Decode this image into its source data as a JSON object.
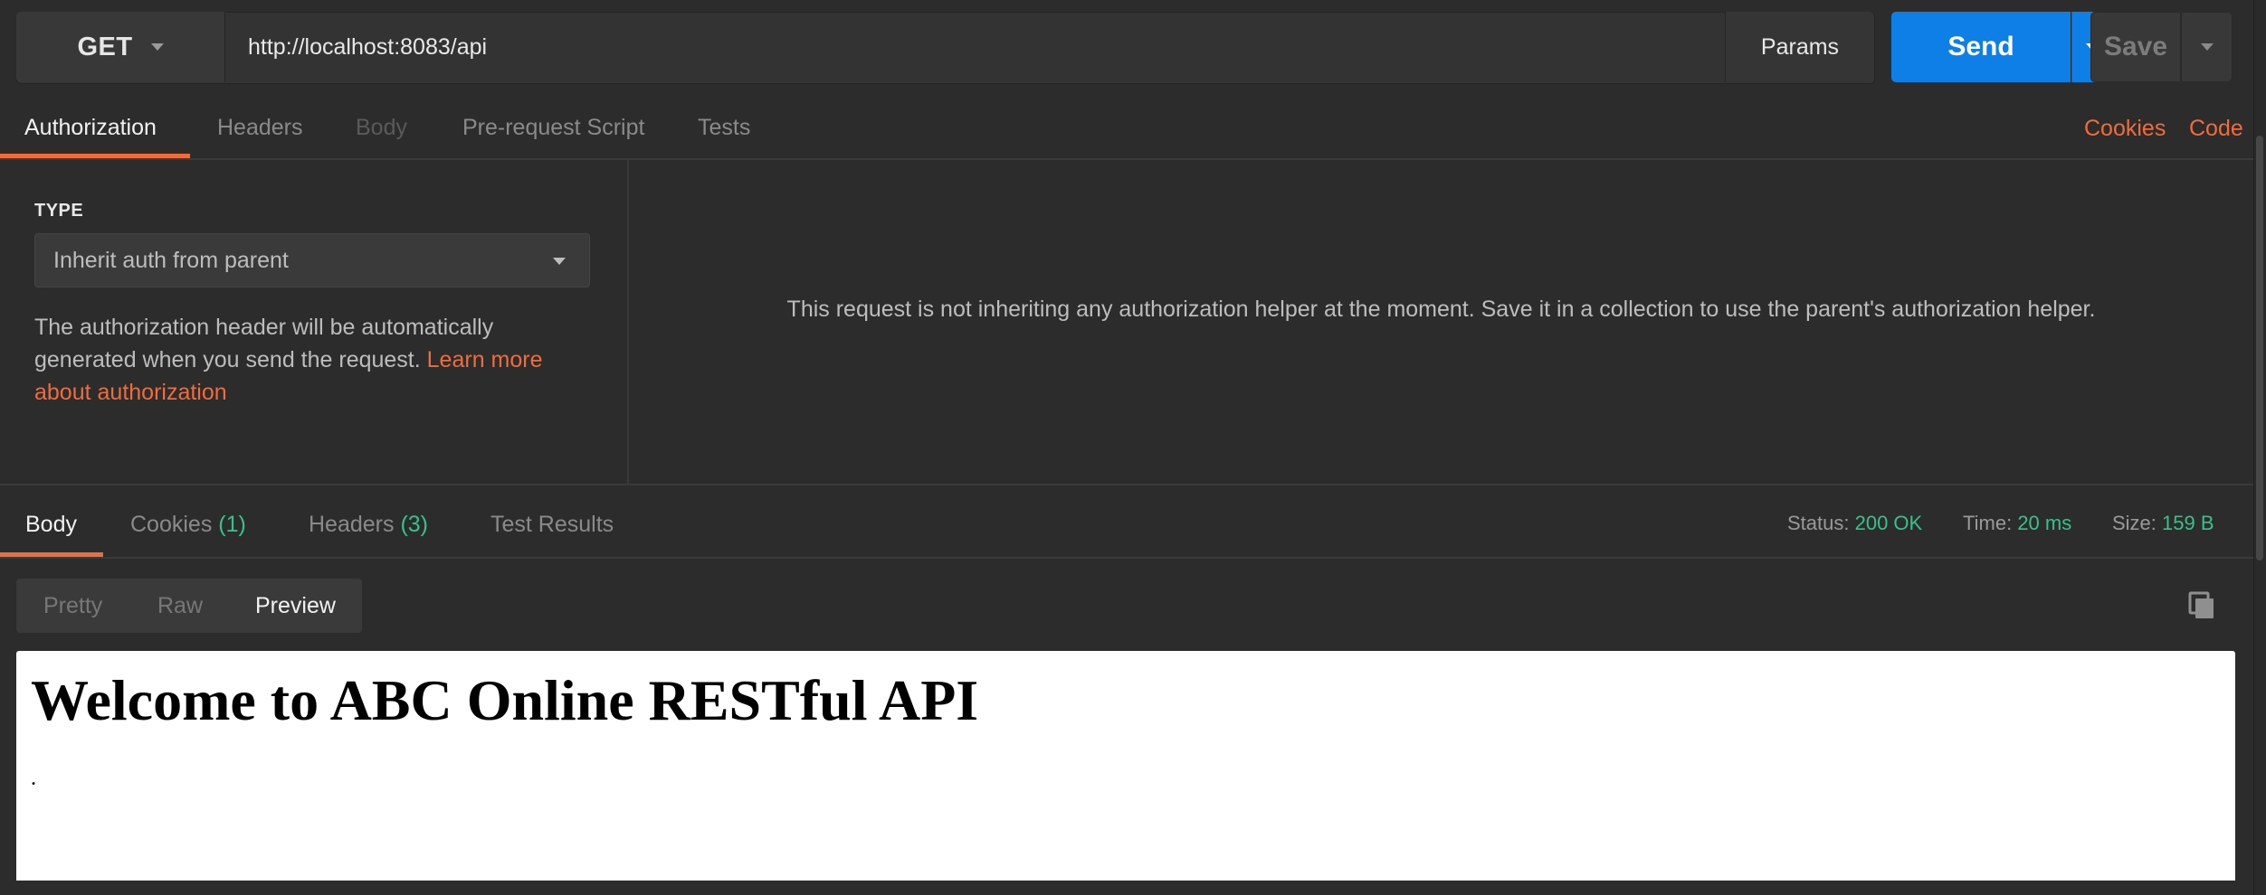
{
  "request": {
    "method": "GET",
    "url": "http://localhost:8083/api",
    "params_label": "Params",
    "send_label": "Send",
    "save_label": "Save"
  },
  "request_tabs": [
    {
      "label": "Authorization",
      "state": "active"
    },
    {
      "label": "Headers",
      "state": "normal"
    },
    {
      "label": "Body",
      "state": "disabled"
    },
    {
      "label": "Pre-request Script",
      "state": "normal"
    },
    {
      "label": "Tests",
      "state": "normal"
    }
  ],
  "links": {
    "cookies": "Cookies",
    "code": "Code"
  },
  "auth": {
    "type_label": "TYPE",
    "type_value": "Inherit auth from parent",
    "description": "The authorization header will be automatically generated when you send the request. ",
    "learn_more": "Learn more about authorization",
    "message": "This request is not inheriting any authorization helper at the moment. Save it in a collection to use the parent's authorization helper."
  },
  "response_tabs": [
    {
      "label": "Body",
      "count": ""
    },
    {
      "label": "Cookies",
      "count": "(1)"
    },
    {
      "label": "Headers",
      "count": "(3)"
    },
    {
      "label": "Test Results",
      "count": ""
    }
  ],
  "status": {
    "status_label": "Status:",
    "status_value": "200 OK",
    "time_label": "Time:",
    "time_value": "20 ms",
    "size_label": "Size:",
    "size_value": "159 B"
  },
  "view_modes": [
    "Pretty",
    "Raw",
    "Preview"
  ],
  "active_view_mode": "Preview",
  "preview": {
    "heading": "Welcome to ABC Online RESTful API",
    "text": "."
  },
  "colors": {
    "accent_orange": "#f26b3a",
    "send_blue": "#0f7fe8",
    "status_green": "#36c28b",
    "background": "#2c2c2c"
  }
}
